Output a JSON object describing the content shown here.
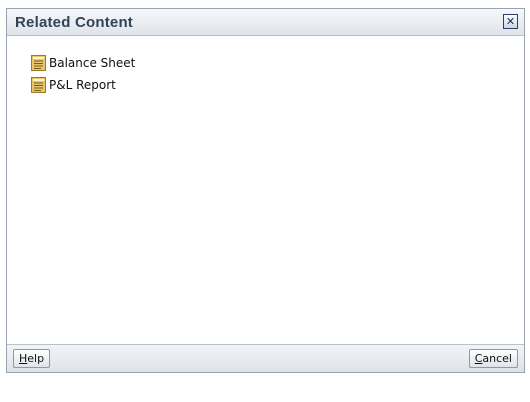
{
  "dialog": {
    "title": "Related Content",
    "close_icon": "close-icon"
  },
  "items": [
    {
      "label": "Balance Sheet",
      "icon": "report-document-icon"
    },
    {
      "label": "P&L Report",
      "icon": "report-document-icon"
    }
  ],
  "footer": {
    "help": {
      "mnemonic": "H",
      "rest": "elp"
    },
    "cancel": {
      "mnemonic": "C",
      "rest": "ancel"
    }
  },
  "colors": {
    "title_text": "#31435a",
    "titlebar_gradient_top": "#f6f8fa",
    "titlebar_gradient_bottom": "#dfe4ea",
    "icon_fill": "#e8c56a",
    "icon_stroke": "#9a7b2a",
    "close_border": "#2a3f62"
  }
}
